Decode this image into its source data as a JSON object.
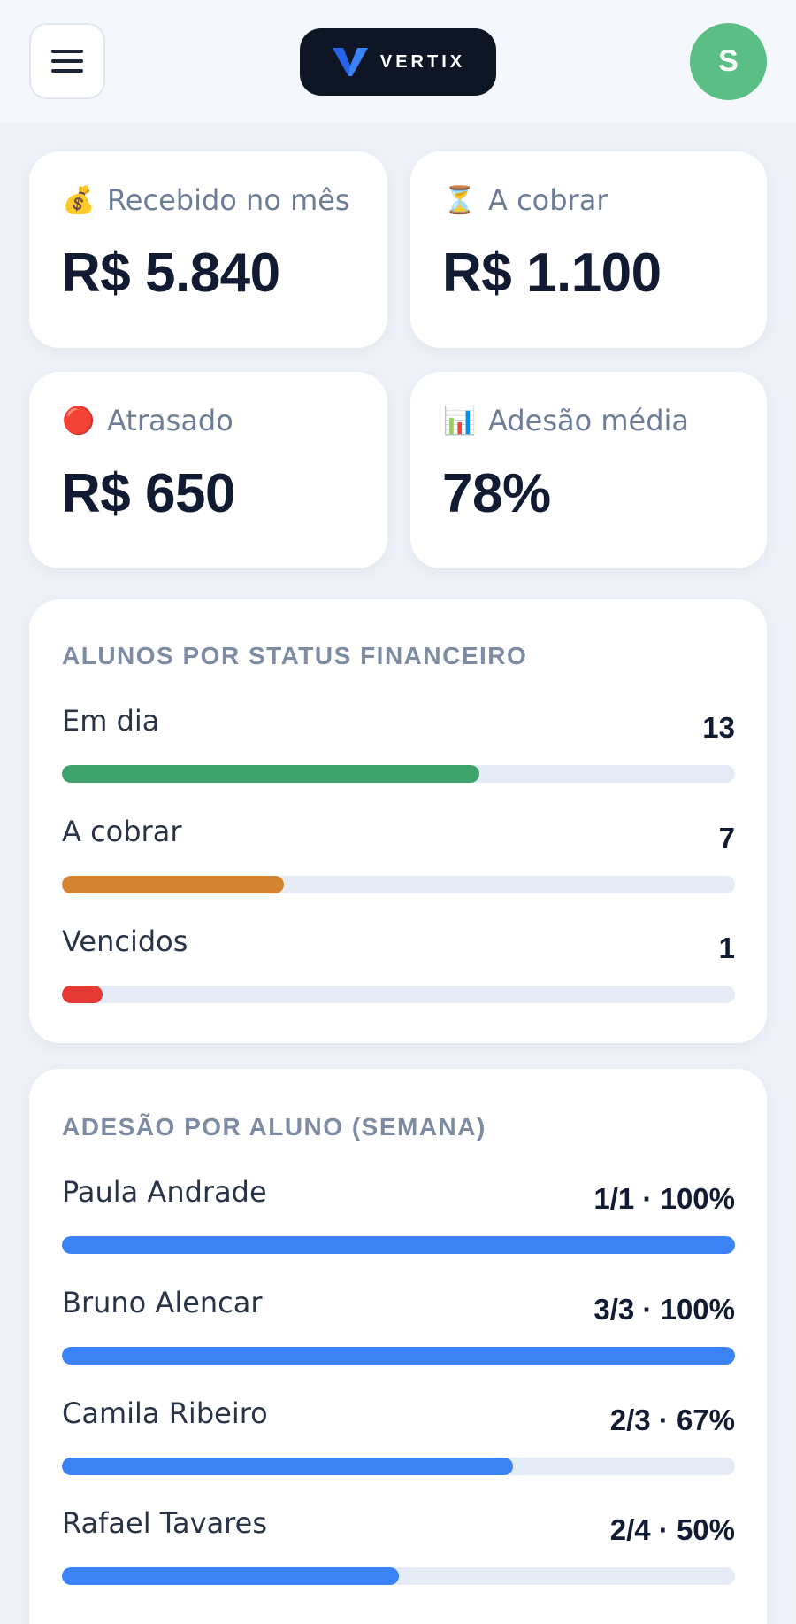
{
  "header": {
    "menu_icon": "hamburger-menu-icon",
    "logo_text": "VERTIX",
    "avatar_initial": "S"
  },
  "stats": [
    {
      "icon": "money-bag-icon",
      "emoji": "💰",
      "label": "Recebido no mês",
      "value": "R$ 5.840"
    },
    {
      "icon": "hourglass-icon",
      "emoji": "⏳",
      "label": "A cobrar",
      "value": "R$ 1.100"
    },
    {
      "icon": "red-circle-icon",
      "emoji": "🔴",
      "label": "Atrasado",
      "value": "R$ 650"
    },
    {
      "icon": "bar-chart-icon",
      "emoji": "📊",
      "label": "Adesão média",
      "value": "78%"
    }
  ],
  "status_section": {
    "title": "ALUNOS POR STATUS FINANCEIRO",
    "rows": [
      {
        "label": "Em dia",
        "value": "13",
        "fraction": 0.62,
        "color": "#3ea36a"
      },
      {
        "label": "A cobrar",
        "value": "7",
        "fraction": 0.33,
        "color": "#d4832e"
      },
      {
        "label": "Vencidos",
        "value": "1",
        "fraction": 0.06,
        "color": "#e53935"
      }
    ]
  },
  "adherence_section": {
    "title": "ADESÃO POR ALUNO (SEMANA)",
    "bar_color": "#3b82f6",
    "rows": [
      {
        "label": "Paula Andrade",
        "value": "1/1 · 100%",
        "fraction": 1.0
      },
      {
        "label": "Bruno Alencar",
        "value": "3/3 · 100%",
        "fraction": 1.0
      },
      {
        "label": "Camila Ribeiro",
        "value": "2/3 · 67%",
        "fraction": 0.67
      },
      {
        "label": "Rafael Tavares",
        "value": "2/4 · 50%",
        "fraction": 0.5
      }
    ]
  },
  "colors": {
    "background": "#eef2f8",
    "avatar": "#5bbf85",
    "logo_bg": "#0e1626",
    "logo_accent": "#3b82f6"
  }
}
